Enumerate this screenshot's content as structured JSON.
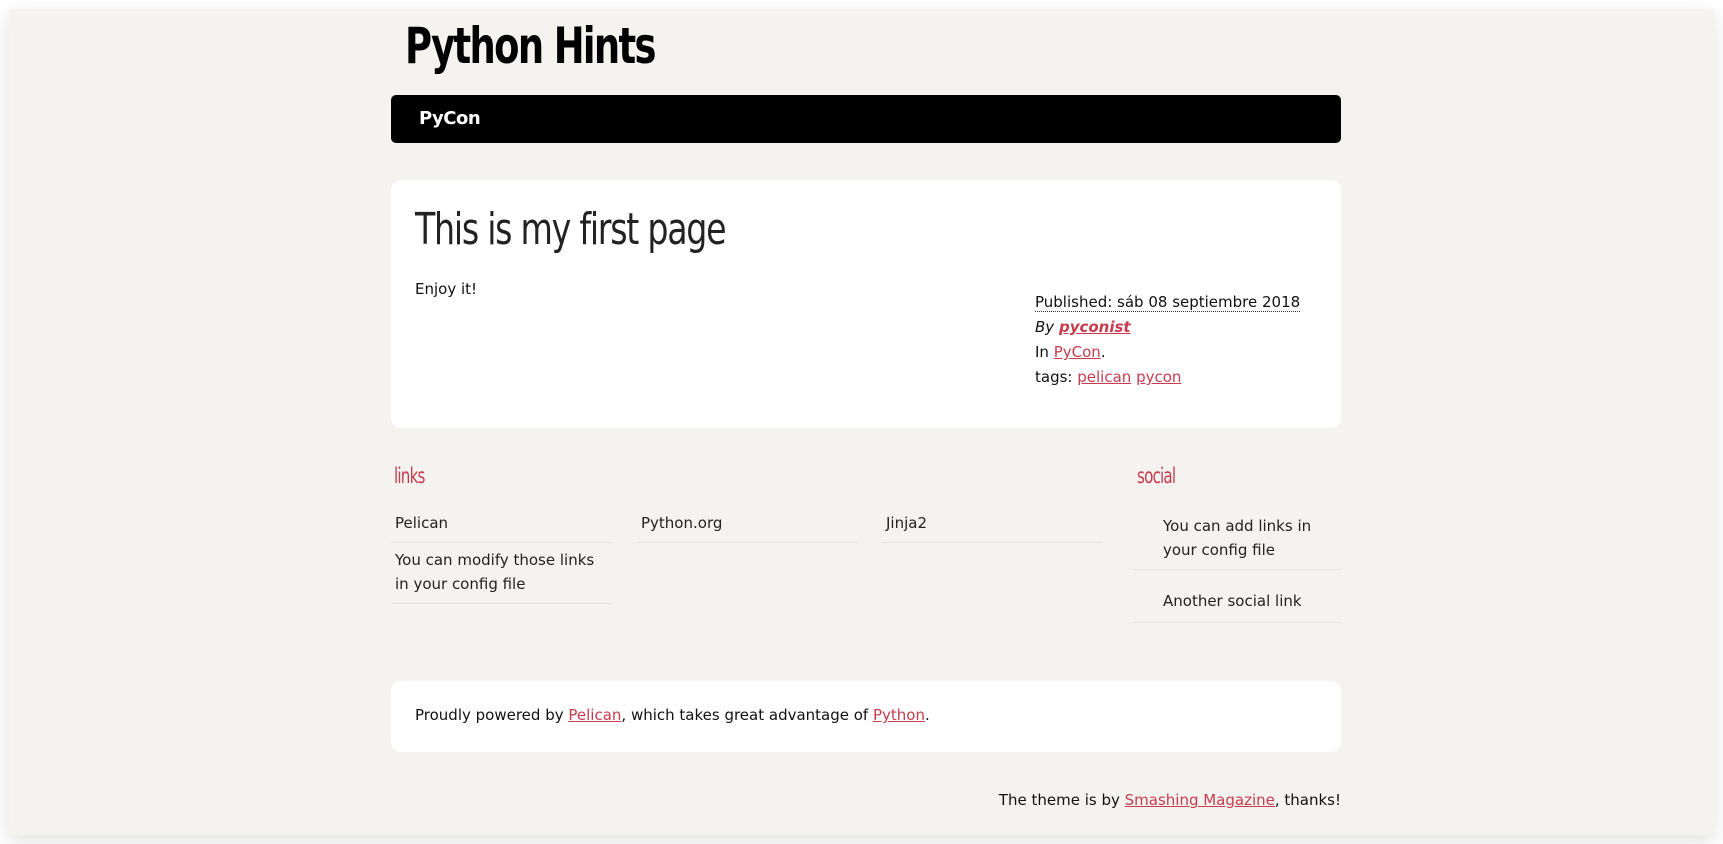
{
  "site": {
    "title": "Python Hints"
  },
  "menu": {
    "items": [
      "PyCon"
    ]
  },
  "article": {
    "title": "This is my first page",
    "body": "Enjoy it!",
    "meta": {
      "published": "Published: sáb 08 septiembre 2018",
      "by_label": "By",
      "author": "pyconist",
      "in_label": "In",
      "category": "PyCon",
      "category_suffix": ".",
      "tags_label": "tags:",
      "tags": [
        "pelican",
        "pycon"
      ]
    }
  },
  "links": {
    "title": "links",
    "items": [
      "Pelican",
      "Python.org",
      "Jinja2",
      "You can modify those links in your config file"
    ]
  },
  "social": {
    "title": "social",
    "items": [
      "You can add links in your config file",
      "Another social link"
    ]
  },
  "footer": {
    "prefix": "Proudly powered by",
    "pelican": "Pelican",
    "middle": ", which takes great advantage of",
    "python": "Python",
    "suffix": "."
  },
  "credits": {
    "prefix": "The theme is by",
    "link": "Smashing Magazine",
    "suffix": ", thanks!"
  }
}
